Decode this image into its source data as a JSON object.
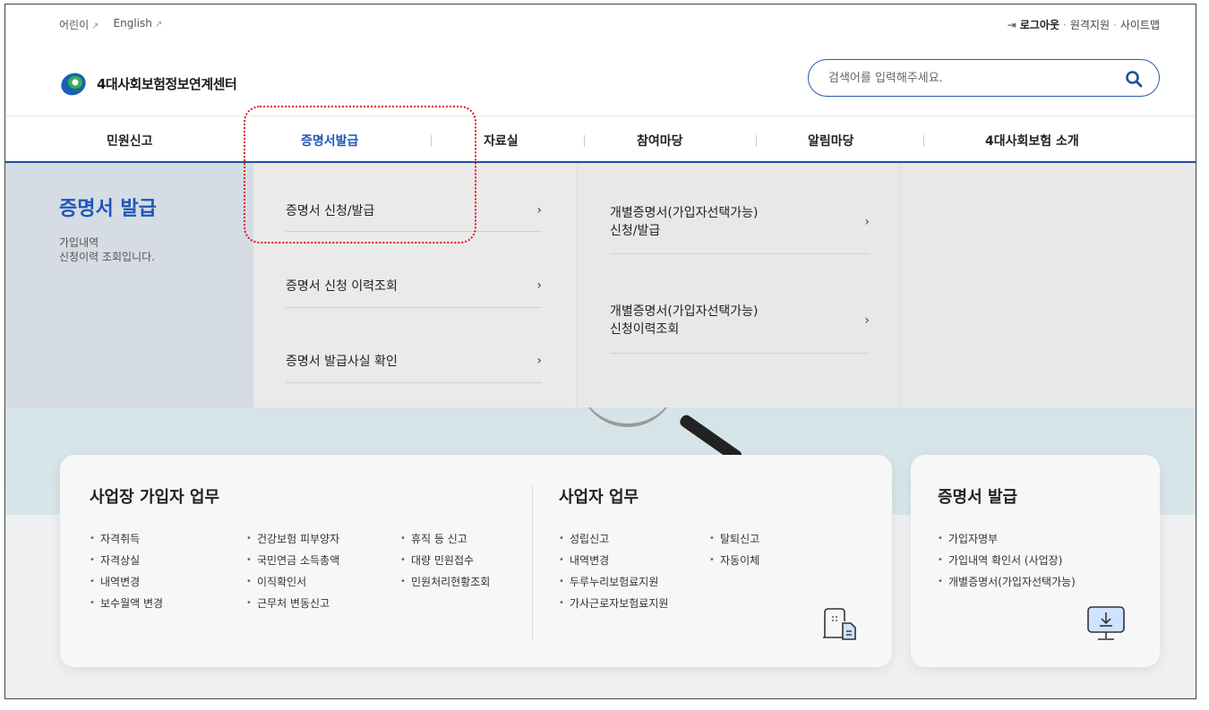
{
  "util": {
    "kids": "어린이",
    "english": "English",
    "logout": "로그아웃",
    "remote": "원격지원",
    "sitemap": "사이트맵",
    "dot": "·"
  },
  "header": {
    "logo_text": "4대사회보험정보연계센터",
    "search_placeholder": "검색어를 입력해주세요."
  },
  "gnb": {
    "items": [
      {
        "label": "민원신고",
        "active": false
      },
      {
        "label": "증명서발급",
        "active": true
      },
      {
        "label": "자료실",
        "active": false
      },
      {
        "label": "참여마당",
        "active": false
      },
      {
        "label": "알림마당",
        "active": false
      },
      {
        "label": "4대사회보험 소개",
        "active": false
      }
    ]
  },
  "mega": {
    "title": "증명서 발급",
    "desc": "가입내역\n신청이력 조회입니다.",
    "col1": [
      "증명서 신청/발급",
      "증명서 신청 이력조회",
      "증명서 발급사실 확인"
    ],
    "col2": [
      "개별증명서(가입자선택가능)\n신청/발급",
      "개별증명서(가입자선택가능)\n신청이력조회"
    ],
    "chevron": "›"
  },
  "cards": {
    "workplace": {
      "title": "사업장 가입자 업무",
      "col_a": [
        "자격취득",
        "자격상실",
        "내역변경",
        "보수월액 변경"
      ],
      "col_b": [
        "건강보험 피부양자",
        "국민연금 소득총액",
        "이직확인서",
        "근무처 변동신고"
      ],
      "col_c": [
        "휴직 등 신고",
        "대량 민원접수",
        "민원처리현황조회"
      ]
    },
    "employer": {
      "title": "사업자 업무",
      "col_a": [
        "성립신고",
        "내역변경",
        "두루누리보험료지원",
        "가사근로자보험료지원"
      ],
      "col_b": [
        "탈퇴신고",
        "자동이체"
      ]
    },
    "cert": {
      "title": "증명서 발급",
      "items": [
        "가입자명부",
        "가입내역 확인서 (사업장)",
        "개별증명서(가입자선택가능)"
      ]
    }
  },
  "colors": {
    "brand_blue": "#1f56b8",
    "highlight_red": "#e0141e"
  }
}
